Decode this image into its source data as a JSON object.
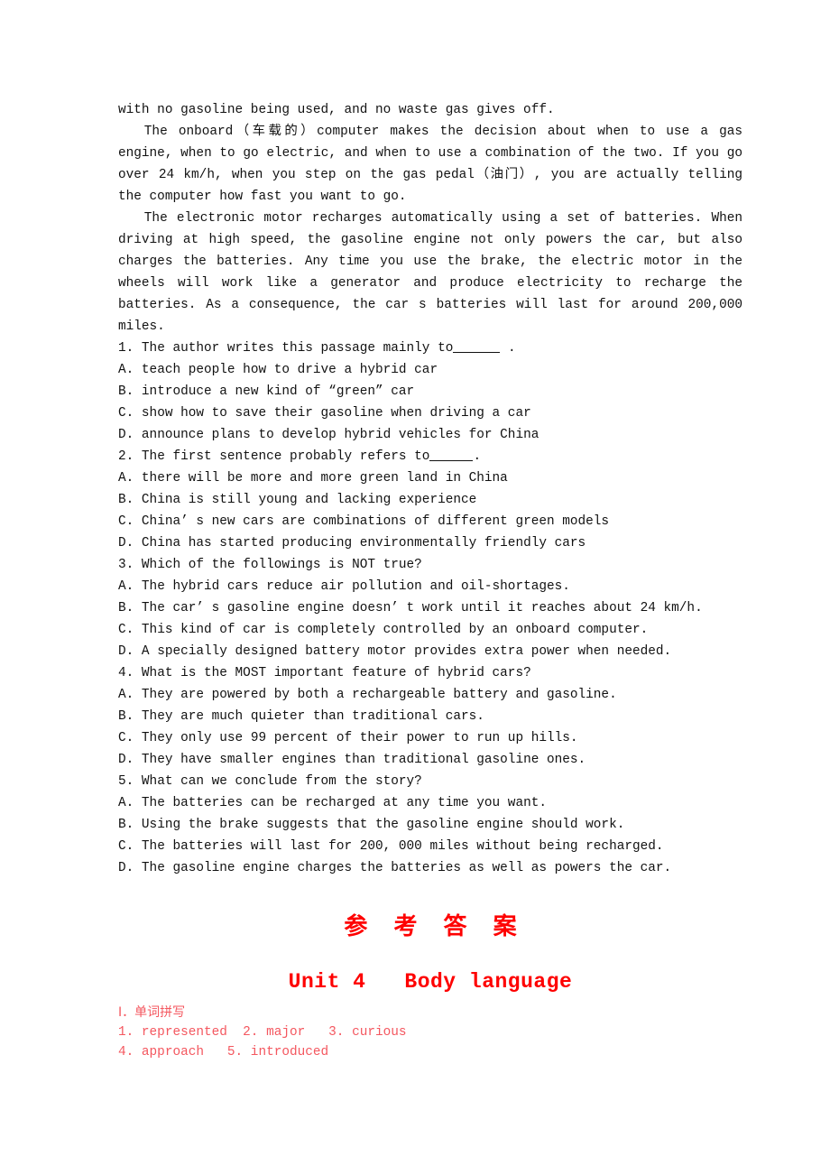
{
  "document": {
    "type": "exam-worksheet-page",
    "language": "en-zh",
    "background_color": "#ffffff",
    "body_text_color": "#111111",
    "accent_red": "#fe0000",
    "answer_red": "#f4575f"
  },
  "passage": {
    "continuation_line": "with no gasoline being used, and no waste gas gives off.",
    "paragraphs": [
      "The onboard（车载的）computer makes the decision about when to use a gas engine, when to go electric, and when to use a combination of the two. If you go over 24 km/h, when you step on the gas pedal（油门）, you are actually telling the computer how fast you want to go.",
      "The electronic motor recharges automatically using a set of batteries. When driving at high speed, the gasoline engine not only powers the car, but also charges the batteries. Any time you use the brake, the electric motor in the wheels will work like a generator and produce electricity to recharge the batteries. As a consequence, the car  s batteries will last for around 200,000 miles."
    ]
  },
  "questions": [
    {
      "number": "1.",
      "stem_before_blank": "The author writes this passage mainly to",
      "stem_after_blank": " .",
      "has_blank": true,
      "options": [
        {
          "letter": "A.",
          "text": "teach people how to drive a hybrid car"
        },
        {
          "letter": "B.",
          "text": "introduce a new kind of “green” car"
        },
        {
          "letter": "C.",
          "text": "show how to save their gasoline when driving a car"
        },
        {
          "letter": "D.",
          "text": "announce plans to develop hybrid vehicles for China"
        }
      ]
    },
    {
      "number": "2.",
      "stem_before_blank": "The first sentence probably refers to",
      "stem_after_blank": ".",
      "has_blank": true,
      "options": [
        {
          "letter": "A.",
          "text": "there will be more and more green land in China"
        },
        {
          "letter": "B.",
          "text": "China is still young and lacking experience"
        },
        {
          "letter": "C.",
          "text": "China’ s new cars are combinations of different green models"
        },
        {
          "letter": "D.",
          "text": "China has started producing environmentally friendly cars"
        }
      ]
    },
    {
      "number": "3.",
      "stem_before_blank": "Which of the followings is NOT true?",
      "stem_after_blank": "",
      "has_blank": false,
      "options": [
        {
          "letter": "A.",
          "text": "The hybrid cars reduce air pollution and oil-shortages."
        },
        {
          "letter": "B.",
          "text": "The car’ s gasoline engine doesn’ t work until it reaches about 24 km/h."
        },
        {
          "letter": "C.",
          "text": "This kind of car is completely controlled by an onboard computer."
        },
        {
          "letter": "D.",
          "text": "A specially designed battery motor provides extra power when needed."
        }
      ]
    },
    {
      "number": "4.",
      "stem_before_blank": "What is the MOST important feature of hybrid cars?",
      "stem_after_blank": "",
      "has_blank": false,
      "options": [
        {
          "letter": "A.",
          "text": "They are powered by both a rechargeable battery and gasoline."
        },
        {
          "letter": "B.",
          "text": "They are much quieter than traditional cars."
        },
        {
          "letter": "C.",
          "text": "They only use 99 percent of their power to run up hills."
        },
        {
          "letter": "D.",
          "text": "They have smaller engines than traditional gasoline ones."
        }
      ]
    },
    {
      "number": "5.",
      "stem_before_blank": "What can we conclude from the story?",
      "stem_after_blank": "",
      "has_blank": false,
      "options": [
        {
          "letter": "A.",
          "text": "The batteries can be recharged at any time you want."
        },
        {
          "letter": "B.",
          "text": "Using the brake suggests that the gasoline engine should work."
        },
        {
          "letter": "C.",
          "text": "The batteries will last for 200, 000 miles without being recharged."
        },
        {
          "letter": "D.",
          "text": "The gasoline engine charges the batteries as well as powers the car."
        }
      ]
    }
  ],
  "answer_key": {
    "heading": "参 考 答 案",
    "unit_title": "Unit 4   Body language",
    "sections": [
      {
        "label": "Ⅰ．单词拼写",
        "lines": [
          "1. represented  2. major   3. curious",
          "4. approach   5. introduced"
        ]
      }
    ]
  }
}
